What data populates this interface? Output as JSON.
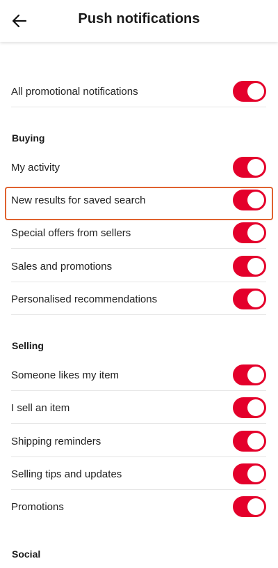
{
  "header": {
    "title": "Push notifications",
    "back_icon": "arrow-left-icon"
  },
  "colors": {
    "toggle_on": "#e4002b",
    "highlight_border": "#e0622f"
  },
  "general": {
    "all_promotional": {
      "label": "All promotional notifications",
      "enabled": true
    }
  },
  "buying": {
    "title": "Buying",
    "items": [
      {
        "label": "My activity",
        "enabled": true
      },
      {
        "label": "New results for saved search",
        "enabled": true,
        "highlighted": true
      },
      {
        "label": "Special offers from sellers",
        "enabled": true
      },
      {
        "label": "Sales and promotions",
        "enabled": true
      },
      {
        "label": "Personalised recommendations",
        "enabled": true
      }
    ]
  },
  "selling": {
    "title": "Selling",
    "items": [
      {
        "label": "Someone likes my item",
        "enabled": true
      },
      {
        "label": "I sell an item",
        "enabled": true
      },
      {
        "label": "Shipping reminders",
        "enabled": true
      },
      {
        "label": "Selling tips and updates",
        "enabled": true
      },
      {
        "label": "Promotions",
        "enabled": true
      }
    ]
  },
  "social": {
    "title": "Social"
  }
}
